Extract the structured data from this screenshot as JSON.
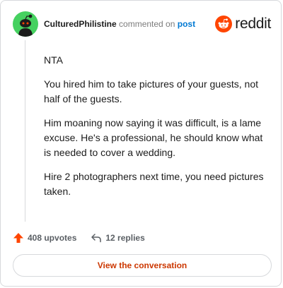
{
  "header": {
    "username": "CulturedPhilistine",
    "action_text": "commented on",
    "post_link": "post",
    "brand": "reddit"
  },
  "comment": {
    "paragraphs": [
      "NTA",
      "You hired him to take pictures of your guests, not half of the guests.",
      "Him moaning now saying it was difficult, is a lame excuse. He's a professional, he should know what is needed to cover a wedding.",
      "Hire 2 photographers next time, you need pictures taken."
    ]
  },
  "actions": {
    "upvotes": "408 upvotes",
    "replies": "12 replies"
  },
  "cta": {
    "label": "View the conversation"
  },
  "colors": {
    "brand_orange": "#ff4500",
    "link_blue": "#0079d3",
    "avatar_green": "#46d160",
    "cta_text": "#cc3700"
  },
  "icons": [
    "snoo-avatar-icon",
    "reddit-logo-icon",
    "upvote-arrow-icon",
    "reply-arrow-icon"
  ]
}
